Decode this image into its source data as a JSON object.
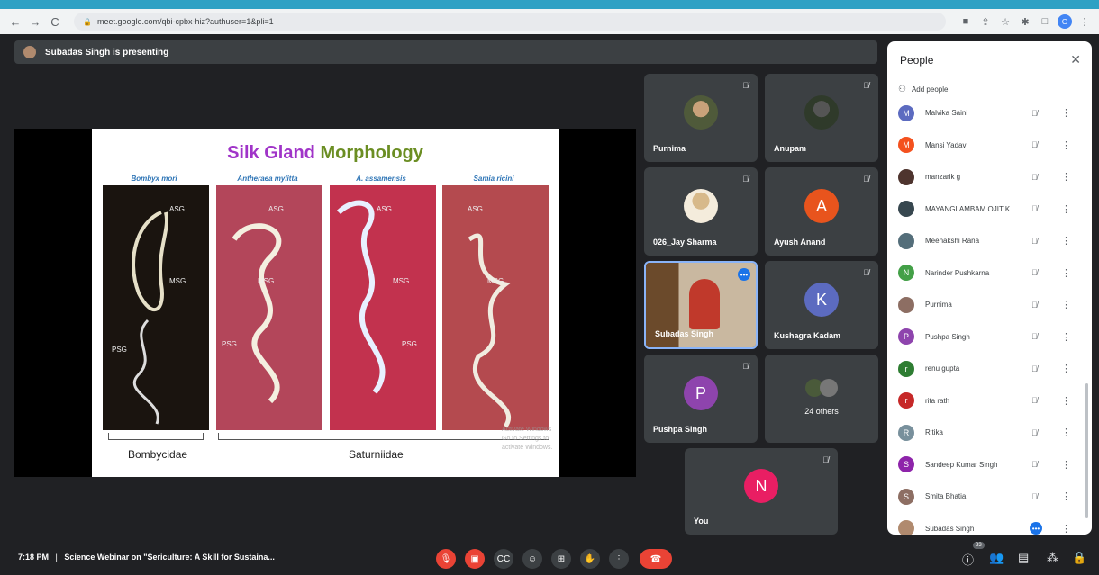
{
  "browser": {
    "url": "meet.google.com/qbi-cpbx-hiz?authuser=1&pli=1",
    "profile_initial": "G"
  },
  "banner": {
    "text": "Subadas Singh is presenting"
  },
  "slide": {
    "title_part1": "Silk Gland",
    "title_part2": "Morphology",
    "species": [
      "Bombyx mori",
      "Antheraea mylitta",
      "A. assamensis",
      "Samia ricini"
    ],
    "gland_labels": {
      "asg": "ASG",
      "msg": "MSG",
      "psg": "PSG"
    },
    "families": [
      "Bombycidae",
      "Saturniidae"
    ],
    "watermark_line1": "Activate Windows",
    "watermark_line2": "Go to Settings to activate Windows."
  },
  "tiles": [
    {
      "name": "Purnima"
    },
    {
      "name": "Anupam"
    },
    {
      "name": "026_Jay Sharma"
    },
    {
      "name": "Ayush Anand",
      "letter": "A",
      "color": "#e8541d"
    },
    {
      "name": "Subadas Singh"
    },
    {
      "name": "Kushagra Kadam",
      "letter": "K",
      "color": "#5c6bc0"
    },
    {
      "name": "Pushpa Singh",
      "letter": "P",
      "color": "#8e44ad"
    },
    {
      "name": "24 others"
    },
    {
      "name": "You",
      "letter": "N",
      "color": "#e91e63"
    }
  ],
  "people": {
    "title": "People",
    "add_label": "Add people",
    "list": [
      {
        "name": "Malvika Saini",
        "initial": "M",
        "color": "#5c6bc0"
      },
      {
        "name": "Mansi Yadav",
        "initial": "M",
        "color": "#f4511e"
      },
      {
        "name": "manzarik g",
        "initial": "",
        "color": "#4e342e"
      },
      {
        "name": "MAYANGLAMBAM OJIT K...",
        "initial": "",
        "color": "#37474f"
      },
      {
        "name": "Meenakshi Rana",
        "initial": "",
        "color": "#546e7a"
      },
      {
        "name": "Narinder Pushkarna",
        "initial": "N",
        "color": "#43a047"
      },
      {
        "name": "Purnima",
        "initial": "",
        "color": "#8d6e63"
      },
      {
        "name": "Pushpa Singh",
        "initial": "P",
        "color": "#8e44ad"
      },
      {
        "name": "renu gupta",
        "initial": "r",
        "color": "#2e7d32"
      },
      {
        "name": "rita rath",
        "initial": "r",
        "color": "#c62828"
      },
      {
        "name": "Ritika",
        "initial": "R",
        "color": "#78909c"
      },
      {
        "name": "Sandeep Kumar Singh",
        "initial": "S",
        "color": "#8e24aa"
      },
      {
        "name": "Smita Bhatia",
        "initial": "S",
        "color": "#8d6e63"
      },
      {
        "name": "Subadas Singh",
        "initial": "",
        "color": "#b08a6e"
      }
    ]
  },
  "bottom": {
    "time": "7:18 PM",
    "separator": "|",
    "meeting_title": "Science Webinar on \"Sericulture: A Skill for Sustaina...",
    "participant_count": "33"
  }
}
